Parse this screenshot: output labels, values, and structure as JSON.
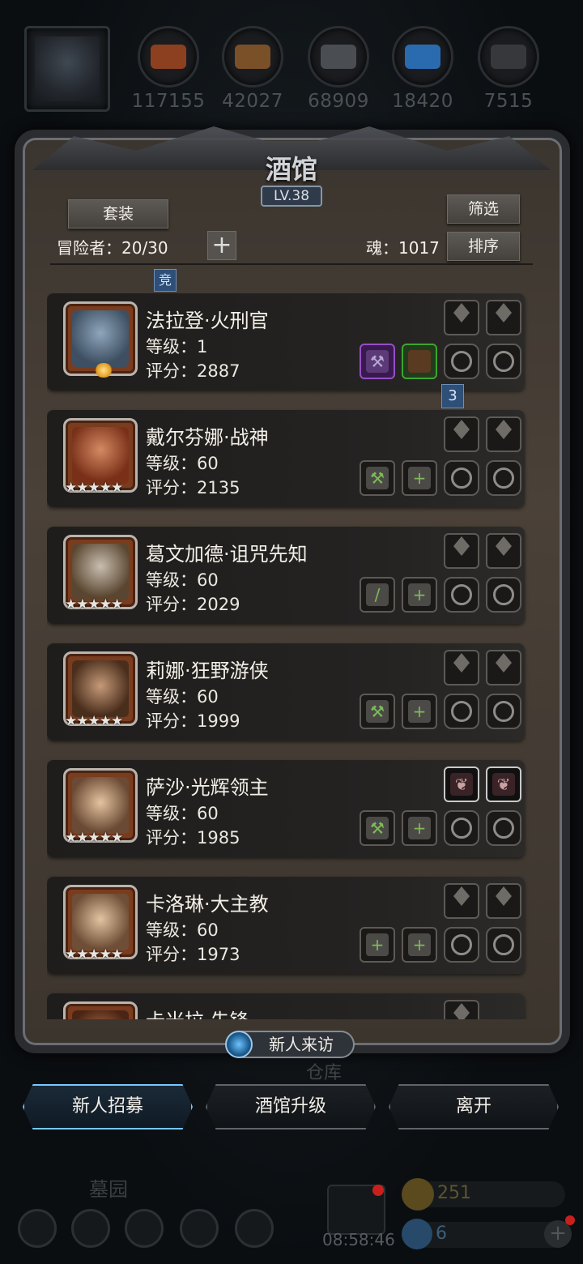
{
  "resources": [
    {
      "name": "meat",
      "value": "117155",
      "color": "#9a4a24"
    },
    {
      "name": "wood",
      "value": "42027",
      "color": "#8a5a2e"
    },
    {
      "name": "iron",
      "value": "68909",
      "color": "#50545a"
    },
    {
      "name": "crystal",
      "value": "18420",
      "color": "#2a6fb8"
    },
    {
      "name": "ore",
      "value": "7515",
      "color": "#3c3e42"
    }
  ],
  "tavern": {
    "title": "酒馆",
    "level": "LV.38",
    "set_button": "套装",
    "filter_button": "筛选",
    "sort_button": "排序",
    "adventurers": "冒险者：20/30",
    "soul": "魂：1017",
    "plus": "+",
    "compete_tag": "竞",
    "num_tag": "3"
  },
  "heroes": [
    {
      "name": "法拉登·火刑官",
      "level": "等级：1",
      "score": "评分：2887",
      "stars": "",
      "portrait": "#5d7386"
    },
    {
      "name": "戴尔芬娜·战神",
      "level": "等级：60",
      "score": "评分：2135",
      "stars": "★★★★★",
      "portrait": "#a4502f"
    },
    {
      "name": "葛文加德·诅咒先知",
      "level": "等级：60",
      "score": "评分：2029",
      "stars": "★★★★★",
      "portrait": "#7c6a55"
    },
    {
      "name": "莉娜·狂野游侠",
      "level": "等级：60",
      "score": "评分：1999",
      "stars": "★★★★★",
      "portrait": "#6c4a33"
    },
    {
      "name": "萨沙·光辉领主",
      "level": "等级：60",
      "score": "评分：1985",
      "stars": "★★★★★",
      "portrait": "#c9a27c"
    },
    {
      "name": "卡洛琳·大主教",
      "level": "等级：60",
      "score": "评分：1973",
      "stars": "★★★★★",
      "portrait": "#c4a07a"
    },
    {
      "name": "卡米拉·先锋",
      "level": "",
      "score": "",
      "stars": "",
      "portrait": "#8a4a2a"
    }
  ],
  "visitor": "新人来访",
  "warehouse": "仓库",
  "buttons": {
    "recruit": "新人招募",
    "upgrade": "酒馆升级",
    "leave": "离开"
  },
  "hud": {
    "graveyard": "墓园",
    "timer": "08:58:46",
    "gold": "251",
    "gems": "6"
  }
}
